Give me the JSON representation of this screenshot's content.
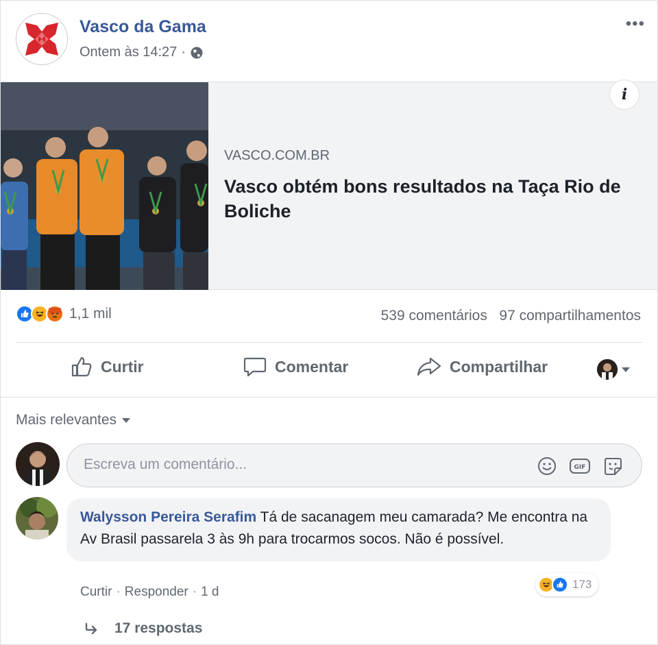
{
  "post": {
    "page_name": "Vasco da Gama",
    "timestamp": "Ontem às 14:27",
    "privacy_icon": "globe-icon",
    "more_label": "•••"
  },
  "link_preview": {
    "domain": "VASCO.COM.BR",
    "title": "Vasco obtém bons resultados na Taça Rio de Boliche",
    "info_label": "i"
  },
  "reactions": {
    "types": [
      "like",
      "haha",
      "angry"
    ],
    "count": "1,1 mil",
    "comments": "539 comentários",
    "shares": "97 compartilhamentos"
  },
  "actions": {
    "like": "Curtir",
    "comment": "Comentar",
    "share": "Compartilhar"
  },
  "comments": {
    "sort_label": "Mais relevantes",
    "input_placeholder": "Escreva um comentário...",
    "items": [
      {
        "author": "Walysson Pereira Serafim",
        "text": "Tá de sacanagem meu camarada? Me encontra na Av Brasil passarela 3 às 9h para trocarmos socos. Não é possível.",
        "like": "Curtir",
        "reply": "Responder",
        "age": "1 d",
        "reaction_count": "173",
        "replies": "17 respostas"
      }
    ]
  },
  "colors": {
    "link_blue": "#385898",
    "like_blue": "#1877f2",
    "vasco_red": "#d7262c",
    "muted": "#606770"
  }
}
